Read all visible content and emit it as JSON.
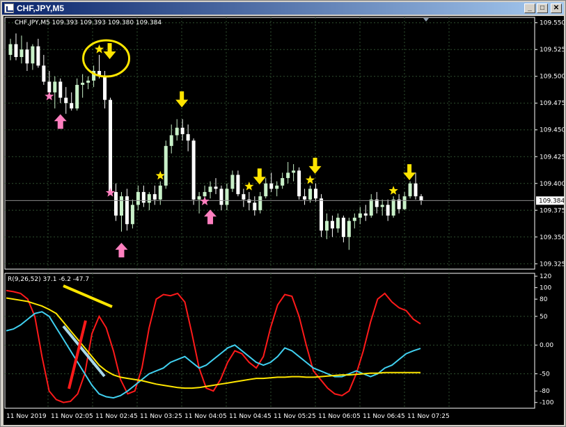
{
  "window": {
    "title": "CHF,JPY,M5",
    "minimize": "_",
    "maximize": "□",
    "close": "✕"
  },
  "colors": {
    "background": "#000000",
    "grid": "#2f4f2f",
    "bull_candle": "#c8f0c8",
    "bear_candle": "#ffffff",
    "up_arrow": "#ff7fbf",
    "down_arrow": "#ffe400",
    "star_buy": "#ff7fbf",
    "star_sell": "#ffe400",
    "osc_red": "#ff1a1a",
    "osc_cyan": "#40d0f0",
    "osc_yellow": "#ffe600",
    "circle": "#ffe600"
  },
  "price_pane": {
    "header": "CHF,JPY,M5  109.393 109.393 109.380 109.384",
    "price_ticks": [
      "109.550",
      "109.525",
      "109.500",
      "109.475",
      "109.450",
      "109.425",
      "109.400",
      "109.375",
      "109.350",
      "109.325"
    ],
    "current_price": "109.384"
  },
  "indicator_pane": {
    "header": "R(9,26,52) 37.1 -6.2 -47.7",
    "ticks": [
      "120",
      "100",
      "80",
      "50",
      "0.00",
      "-50",
      "-80",
      "-100"
    ]
  },
  "time_axis": [
    "11 Nov 2019",
    "11 Nov 02:05",
    "11 Nov 02:45",
    "11 Nov 03:25",
    "11 Nov 04:05",
    "11 Nov 04:45",
    "11 Nov 05:25",
    "11 Nov 06:05",
    "11 Nov 06:45",
    "11 Nov 07:25"
  ],
  "chart_data": {
    "type": "candlestick",
    "symbol": "CHFJPY",
    "timeframe": "M5",
    "ylim": [
      109.32,
      109.555
    ],
    "candles": [
      [
        109.52,
        109.535,
        109.515,
        109.53
      ],
      [
        109.53,
        109.54,
        109.515,
        109.518
      ],
      [
        109.518,
        109.538,
        109.512,
        109.525
      ],
      [
        109.525,
        109.532,
        109.505,
        109.512
      ],
      [
        109.512,
        109.53,
        109.506,
        109.528
      ],
      [
        109.528,
        109.535,
        109.508,
        109.51
      ],
      [
        109.51,
        109.52,
        109.492,
        109.495
      ],
      [
        109.495,
        109.505,
        109.48,
        109.485
      ],
      [
        109.485,
        109.5,
        109.47,
        109.495
      ],
      [
        109.495,
        109.498,
        109.475,
        109.48
      ],
      [
        109.48,
        109.49,
        109.465,
        109.475
      ],
      [
        109.475,
        109.485,
        109.468,
        109.47
      ],
      [
        109.47,
        109.498,
        109.468,
        109.492
      ],
      [
        109.492,
        109.502,
        109.48,
        109.494
      ],
      [
        109.494,
        109.5,
        109.488,
        109.496
      ],
      [
        109.496,
        109.51,
        109.49,
        109.505
      ],
      [
        109.505,
        109.52,
        109.498,
        109.5
      ],
      [
        109.5,
        109.505,
        109.47,
        109.478
      ],
      [
        109.478,
        109.48,
        109.39,
        109.392
      ],
      [
        109.392,
        109.4,
        109.365,
        109.37
      ],
      [
        109.37,
        109.392,
        109.355,
        109.388
      ],
      [
        109.388,
        109.395,
        109.356,
        109.362
      ],
      [
        109.362,
        109.385,
        109.358,
        109.38
      ],
      [
        109.38,
        109.398,
        109.375,
        109.392
      ],
      [
        109.392,
        109.398,
        109.378,
        109.382
      ],
      [
        109.382,
        109.392,
        109.375,
        109.39
      ],
      [
        109.39,
        109.398,
        109.38,
        109.385
      ],
      [
        109.385,
        109.402,
        109.38,
        109.398
      ],
      [
        109.398,
        109.44,
        109.395,
        109.435
      ],
      [
        109.435,
        109.455,
        109.428,
        109.445
      ],
      [
        109.445,
        109.46,
        109.44,
        109.452
      ],
      [
        109.452,
        109.46,
        109.44,
        109.446
      ],
      [
        109.446,
        109.455,
        109.43,
        109.44
      ],
      [
        109.44,
        109.442,
        109.38,
        109.385
      ],
      [
        109.385,
        109.392,
        109.372,
        109.388
      ],
      [
        109.388,
        109.398,
        109.382,
        109.392
      ],
      [
        109.392,
        109.402,
        109.386,
        109.397
      ],
      [
        109.397,
        109.405,
        109.39,
        109.395
      ],
      [
        109.395,
        109.398,
        109.375,
        109.38
      ],
      [
        109.38,
        109.4,
        109.375,
        109.395
      ],
      [
        109.395,
        109.412,
        109.392,
        109.408
      ],
      [
        109.408,
        109.412,
        109.388,
        109.39
      ],
      [
        109.39,
        109.395,
        109.378,
        109.385
      ],
      [
        109.385,
        109.392,
        109.375,
        109.382
      ],
      [
        109.382,
        109.388,
        109.37,
        109.375
      ],
      [
        109.375,
        109.392,
        109.372,
        109.388
      ],
      [
        109.388,
        109.405,
        109.386,
        109.4
      ],
      [
        109.4,
        109.41,
        109.392,
        109.395
      ],
      [
        109.395,
        109.402,
        109.388,
        109.398
      ],
      [
        109.398,
        109.41,
        109.395,
        109.405
      ],
      [
        109.405,
        109.42,
        109.4,
        109.41
      ],
      [
        109.41,
        109.418,
        109.402,
        109.412
      ],
      [
        109.412,
        109.415,
        109.385,
        109.388
      ],
      [
        109.388,
        109.395,
        109.38,
        109.385
      ],
      [
        109.385,
        109.398,
        109.382,
        109.395
      ],
      [
        109.395,
        109.4,
        109.383,
        109.386
      ],
      [
        109.386,
        109.39,
        109.35,
        109.356
      ],
      [
        109.356,
        109.372,
        109.348,
        109.365
      ],
      [
        109.365,
        109.37,
        109.35,
        109.358
      ],
      [
        109.358,
        109.372,
        109.354,
        109.368
      ],
      [
        109.368,
        109.37,
        109.345,
        109.35
      ],
      [
        109.35,
        109.368,
        109.338,
        109.365
      ],
      [
        109.365,
        109.372,
        109.358,
        109.368
      ],
      [
        109.368,
        109.378,
        109.362,
        109.372
      ],
      [
        109.372,
        109.38,
        109.365,
        109.37
      ],
      [
        109.37,
        109.39,
        109.368,
        109.385
      ],
      [
        109.385,
        109.392,
        109.372,
        109.378
      ],
      [
        109.378,
        109.385,
        109.37,
        109.38
      ],
      [
        109.38,
        109.385,
        109.365,
        109.37
      ],
      [
        109.37,
        109.388,
        109.368,
        109.385
      ],
      [
        109.385,
        109.39,
        109.372,
        109.376
      ],
      [
        109.376,
        109.392,
        109.375,
        109.388
      ],
      [
        109.388,
        109.402,
        109.386,
        109.4
      ],
      [
        109.4,
        109.41,
        109.385,
        109.388
      ],
      [
        109.388,
        109.39,
        109.38,
        109.384
      ]
    ],
    "up_arrows_idx": [
      9,
      20,
      36
    ],
    "down_arrows_idx": [
      17,
      30,
      44,
      54,
      71
    ],
    "pink_stars_idx": [
      7,
      18,
      35
    ],
    "yellow_stars_idx": [
      16,
      27,
      43,
      54,
      69
    ],
    "oscillator": {
      "title": "R(9,26,52)",
      "ylim": [
        -110,
        125
      ],
      "series": [
        {
          "name": "R9",
          "values": [
            95,
            93,
            90,
            80,
            50,
            -20,
            -80,
            -95,
            -100,
            -98,
            -85,
            -50,
            20,
            50,
            30,
            -10,
            -60,
            -85,
            -80,
            -40,
            30,
            80,
            88,
            86,
            90,
            75,
            20,
            -40,
            -75,
            -80,
            -60,
            -30,
            -10,
            -15,
            -30,
            -40,
            -20,
            30,
            70,
            88,
            85,
            50,
            0,
            -45,
            -60,
            -75,
            -85,
            -88,
            -80,
            -50,
            -10,
            40,
            80,
            90,
            75,
            65,
            60,
            45,
            37
          ]
        },
        {
          "name": "R26",
          "values": [
            25,
            28,
            35,
            45,
            55,
            58,
            50,
            30,
            10,
            -10,
            -30,
            -50,
            -70,
            -85,
            -90,
            -92,
            -88,
            -80,
            -70,
            -60,
            -50,
            -45,
            -40,
            -30,
            -25,
            -20,
            -30,
            -40,
            -35,
            -25,
            -15,
            -5,
            0,
            -10,
            -20,
            -30,
            -35,
            -30,
            -20,
            -5,
            -10,
            -20,
            -30,
            -40,
            -45,
            -50,
            -55,
            -55,
            -50,
            -45,
            -50,
            -55,
            -50,
            -40,
            -35,
            -25,
            -15,
            -10,
            -6
          ]
        },
        {
          "name": "R52",
          "values": [
            82,
            80,
            78,
            76,
            72,
            68,
            62,
            55,
            40,
            25,
            10,
            -5,
            -20,
            -35,
            -45,
            -52,
            -56,
            -58,
            -60,
            -62,
            -65,
            -68,
            -70,
            -72,
            -74,
            -75,
            -75,
            -74,
            -72,
            -70,
            -68,
            -66,
            -64,
            -62,
            -60,
            -58,
            -58,
            -57,
            -56,
            -56,
            -55,
            -55,
            -56,
            -56,
            -55,
            -54,
            -53,
            -52,
            -52,
            -51,
            -50,
            -49,
            -49,
            -48,
            -48,
            -48,
            -48,
            -48,
            -48
          ]
        }
      ]
    }
  }
}
